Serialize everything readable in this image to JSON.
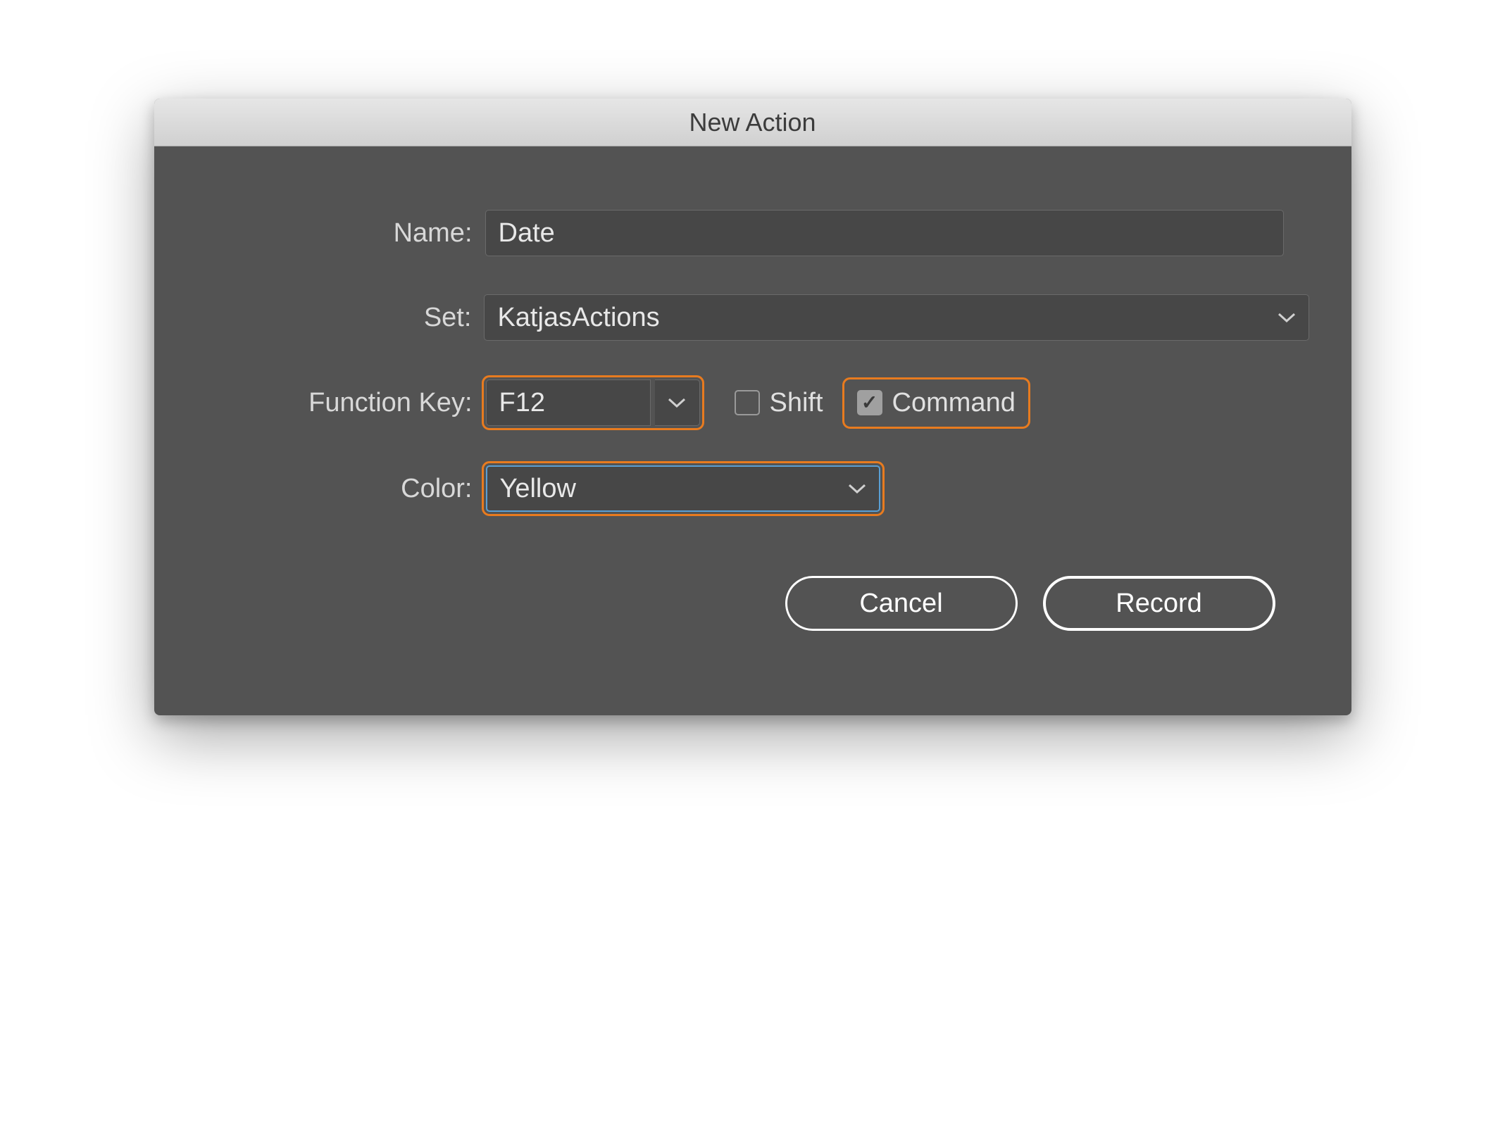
{
  "dialog": {
    "title": "New Action"
  },
  "labels": {
    "name": "Name:",
    "set": "Set:",
    "function_key": "Function Key:",
    "color": "Color:"
  },
  "fields": {
    "name_value": "Date",
    "set_value": "KatjasActions",
    "function_key_value": "F12",
    "shift_label": "Shift",
    "shift_checked": false,
    "command_label": "Command",
    "command_checked": true,
    "color_value": "Yellow"
  },
  "buttons": {
    "cancel": "Cancel",
    "record": "Record"
  }
}
